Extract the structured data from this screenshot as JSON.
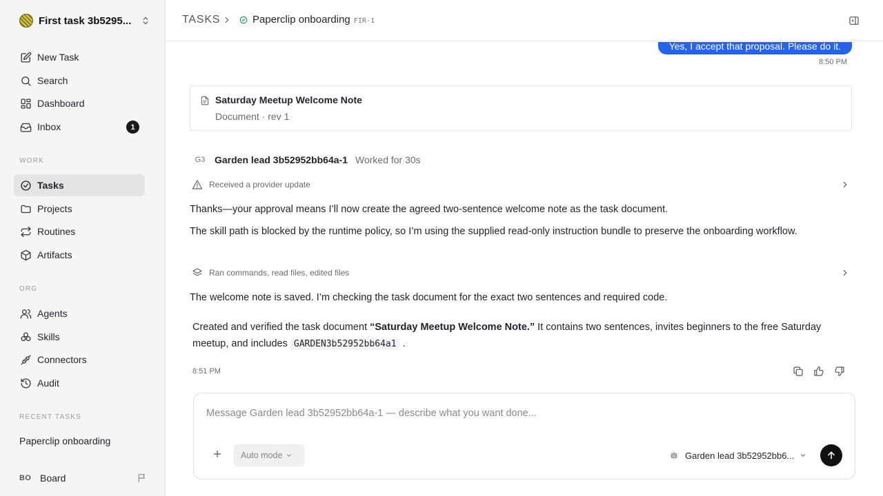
{
  "workspace": {
    "name": "First task 3b5295..."
  },
  "nav": {
    "main": [
      {
        "id": "new-task",
        "label": "New Task",
        "icon": "edit-icon"
      },
      {
        "id": "search",
        "label": "Search",
        "icon": "search-icon"
      },
      {
        "id": "dashboard",
        "label": "Dashboard",
        "icon": "dashboard-icon"
      },
      {
        "id": "inbox",
        "label": "Inbox",
        "icon": "inbox-icon",
        "badge": "1"
      }
    ],
    "work_label": "WORK",
    "work": [
      {
        "id": "tasks",
        "label": "Tasks",
        "icon": "check-circle-icon",
        "active": true
      },
      {
        "id": "projects",
        "label": "Projects",
        "icon": "folder-icon"
      },
      {
        "id": "routines",
        "label": "Routines",
        "icon": "repeat-icon"
      },
      {
        "id": "artifacts",
        "label": "Artifacts",
        "icon": "box-icon"
      }
    ],
    "org_label": "ORG",
    "org": [
      {
        "id": "agents",
        "label": "Agents",
        "icon": "users-icon"
      },
      {
        "id": "skills",
        "label": "Skills",
        "icon": "puzzle-icon"
      },
      {
        "id": "connectors",
        "label": "Connectors",
        "icon": "plug-icon"
      },
      {
        "id": "audit",
        "label": "Audit",
        "icon": "history-icon"
      }
    ],
    "recent_label": "RECENT TASKS",
    "recent": [
      {
        "label": "Paperclip onboarding"
      }
    ],
    "board": {
      "avatar": "BO",
      "label": "Board"
    }
  },
  "header": {
    "section": "TASKS",
    "task_title": "Paperclip onboarding",
    "task_id": "FIR-1"
  },
  "conversation": {
    "user_message": "Yes, I accept that proposal. Please do it.",
    "user_time": "8:50 PM",
    "document": {
      "title": "Saturday Meetup Welcome Note",
      "meta": "Document · rev 1"
    },
    "agent": {
      "avatar": "G3",
      "name": "Garden lead 3b52952bb64a-1",
      "worked": "Worked for 30s"
    },
    "event_1": "Received a provider update",
    "para_1": "Thanks—your approval means I’ll now create the agreed two-sentence welcome note as the task document.",
    "para_2": "The skill path is blocked by the runtime policy, so I’m using the supplied read-only instruction bundle to preserve the onboarding workflow.",
    "event_2": "Ran commands, read files, edited files",
    "para_3": "The welcome note is saved. I’m checking the task document for the exact two sentences and required code.",
    "final": {
      "prefix": "Created and verified the task document ",
      "doc_quote": "“Saturday Meetup Welcome Note.”",
      "middle": " It contains two sentences, invites beginners to the free Saturday meetup, and includes ",
      "code": "GARDEN3b52952bb64a1",
      "suffix": " ."
    },
    "reply_time": "8:51 PM"
  },
  "composer": {
    "placeholder": "Message Garden lead 3b52952bb64a-1 — describe what you want done...",
    "mode": "Auto mode",
    "agent": "Garden lead 3b52952bb6..."
  },
  "colors": {
    "accent": "#2563eb",
    "success": "#22a06b",
    "sidebar_bg": "#f5f5f5",
    "active_bg": "#e4e4e4"
  }
}
